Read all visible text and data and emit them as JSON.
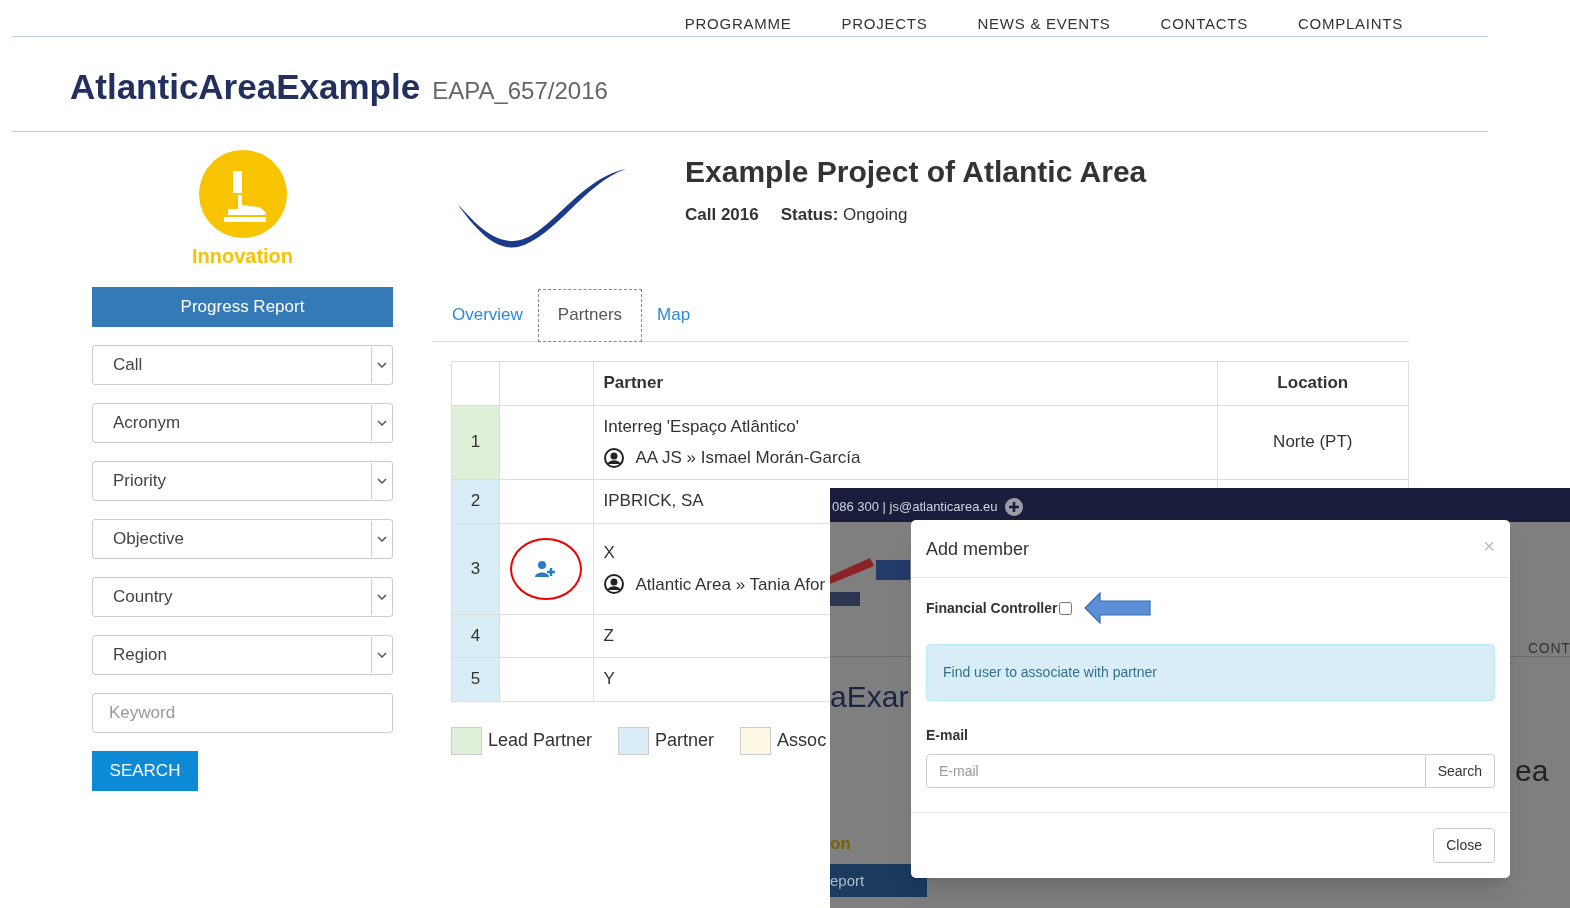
{
  "nav": [
    "PROGRAMME",
    "PROJECTS",
    "NEWS & EVENTS",
    "CONTACTS",
    "COMPLAINTS"
  ],
  "header": {
    "title": "AtlanticAreaExample",
    "code": "EAPA_657/2016"
  },
  "sidebar": {
    "category": "Innovation",
    "progress_button": "Progress Report",
    "filters": [
      "Call",
      "Acronym",
      "Priority",
      "Objective",
      "Country",
      "Region"
    ],
    "keyword_placeholder": "Keyword",
    "search_button": "SEARCH"
  },
  "project": {
    "title": "Example Project of Atlantic Area",
    "call": "Call 2016",
    "status_label": "Status:",
    "status": "Ongoing"
  },
  "tabs": [
    {
      "label": "Overview",
      "selected": false
    },
    {
      "label": "Partners",
      "selected": true
    },
    {
      "label": "Map",
      "selected": false
    }
  ],
  "table": {
    "columns": [
      "Partner",
      "Location"
    ],
    "rows": [
      {
        "number": "1",
        "color": "#dff0d8",
        "add_member": false,
        "name": "Interreg 'Espaço Atlântico'",
        "contact": "AA JS » Ismael Morán-García",
        "location": "Norte (PT)"
      },
      {
        "number": "2",
        "color": "#d9edf7",
        "add_member": false,
        "name": "IPBRICK, SA"
      },
      {
        "number": "3",
        "color": "#d9edf7",
        "add_member": true,
        "name": "X",
        "contact": "Atlantic Area » Tania Afor"
      },
      {
        "number": "4",
        "color": "#d9edf7",
        "add_member": false,
        "name": "Z"
      },
      {
        "number": "5",
        "color": "#d9edf7",
        "add_member": false,
        "name": "Y"
      }
    ]
  },
  "legend": [
    {
      "label": "Lead Partner",
      "color": "#dff0d8"
    },
    {
      "label": "Partner",
      "color": "#d9edf7"
    },
    {
      "label": "Assoc",
      "color": "#fcf8e3"
    }
  ],
  "overlay": {
    "topbar_text": "086 300 | js@atlanticarea.eu",
    "fragments": [
      "CONT",
      "aExar",
      "ea",
      "on",
      "eport"
    ],
    "modal": {
      "title": "Add member",
      "close": "×",
      "checkbox_label": "Financial Controller",
      "checked": false,
      "info": "Find user to associate with partner",
      "email_label": "E-mail",
      "email_placeholder": "E-mail",
      "search_button": "Search",
      "close_button": "Close"
    }
  }
}
